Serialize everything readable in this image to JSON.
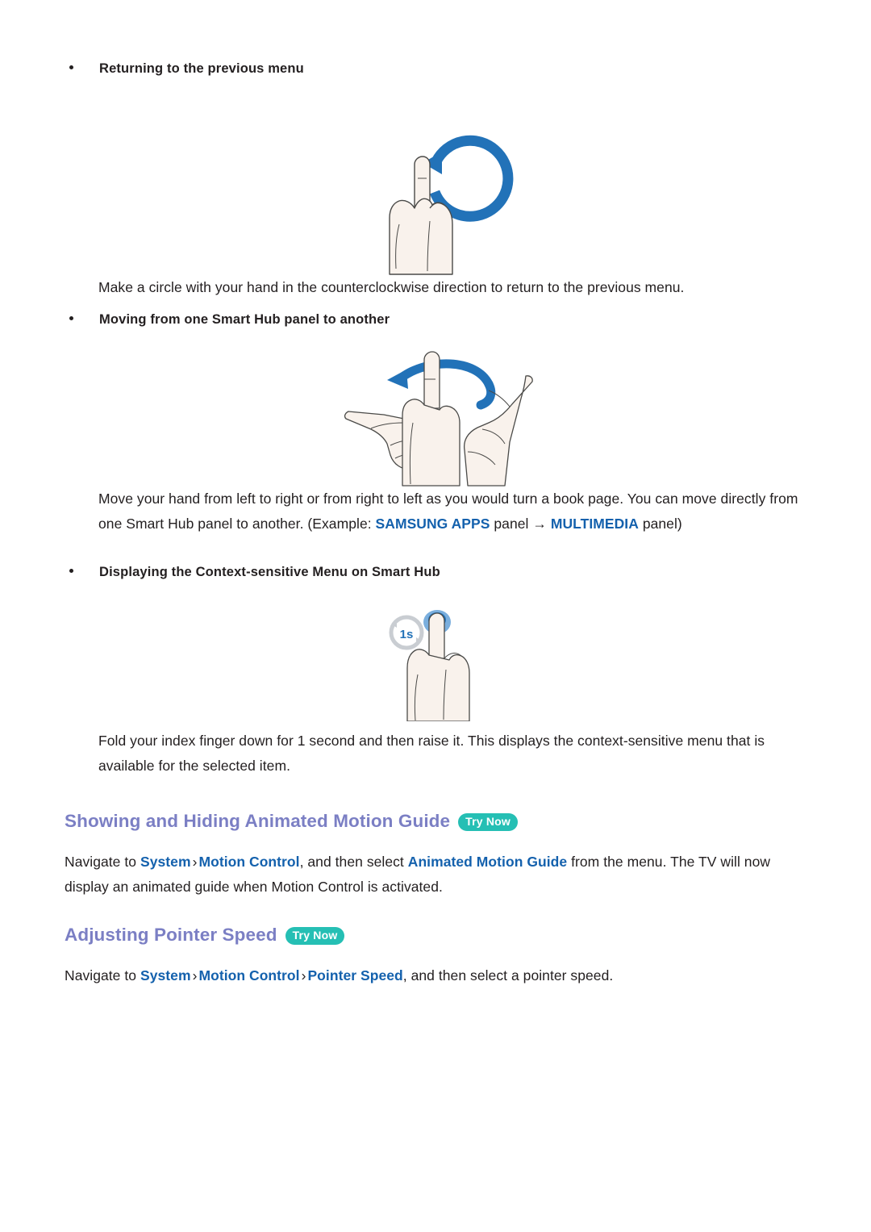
{
  "page": {
    "background": "#ffffff",
    "text_color": "#231f20",
    "link_color": "#1461ad",
    "heading_color": "#7b7fc4",
    "badge_color": "#25bfb4",
    "illustration_blue": "#2272b8",
    "skin_fill": "#f7efe9"
  },
  "sections": [
    {
      "bullet": "Returning to the previous menu",
      "illustration": "circular-counterclockwise-gesture",
      "caption": "Make a circle with your hand in the counterclockwise direction to return to the previous menu."
    },
    {
      "bullet": "Moving from one Smart Hub panel to another",
      "illustration": "swipe-hand-left-right-gesture",
      "caption_parts": {
        "line1": "Move your hand from left to right or from right to left as you would turn a book page. You",
        "line2_pre": "can move directly from one Smart Hub panel to another. (Example: ",
        "link1": "SAMSUNG APPS",
        "line2_mid": " panel ",
        "arrow": "→",
        "link2": "MULTIMEDIA",
        "line3_post": " panel)"
      }
    },
    {
      "bullet": "Displaying the Context-sensitive Menu on Smart Hub",
      "illustration": "fold-index-finger-one-second-gesture",
      "badge_label": "1s",
      "caption_line1": "Fold your index finger down for 1 second and then raise it. This displays the context-sensitive",
      "caption_line2": "menu that is available for the selected item."
    }
  ],
  "topics": [
    {
      "title": "Showing and Hiding Animated Motion Guide",
      "try_now": "Try Now",
      "body": {
        "pre": "Navigate to ",
        "path": [
          "System",
          "Motion Control"
        ],
        "separator": "›",
        "mid": ", and then select ",
        "target": "Animated Motion Guide",
        "post1": " from the menu. The TV",
        "post2": "will now display an animated guide when Motion Control is activated."
      }
    },
    {
      "title": "Adjusting Pointer Speed",
      "try_now": "Try Now",
      "body": {
        "pre": "Navigate to ",
        "path": [
          "System",
          "Motion Control",
          "Pointer Speed"
        ],
        "separator": "›",
        "post": ", and then select a pointer speed."
      }
    }
  ]
}
